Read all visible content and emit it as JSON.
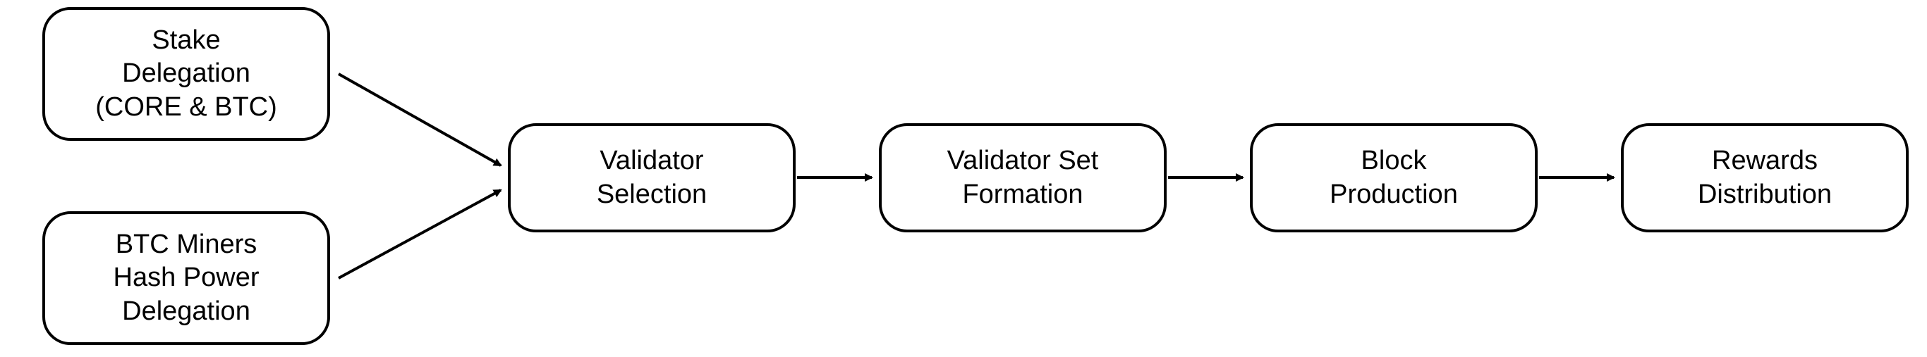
{
  "nodes": {
    "stake_delegation": "Stake\nDelegation\n(CORE & BTC)",
    "btc_miners": "BTC Miners\nHash Power\nDelegation",
    "validator_selection": "Validator\nSelection",
    "validator_set_formation": "Validator Set\nFormation",
    "block_production": "Block\nProduction",
    "rewards_distribution": "Rewards\nDistribution"
  }
}
